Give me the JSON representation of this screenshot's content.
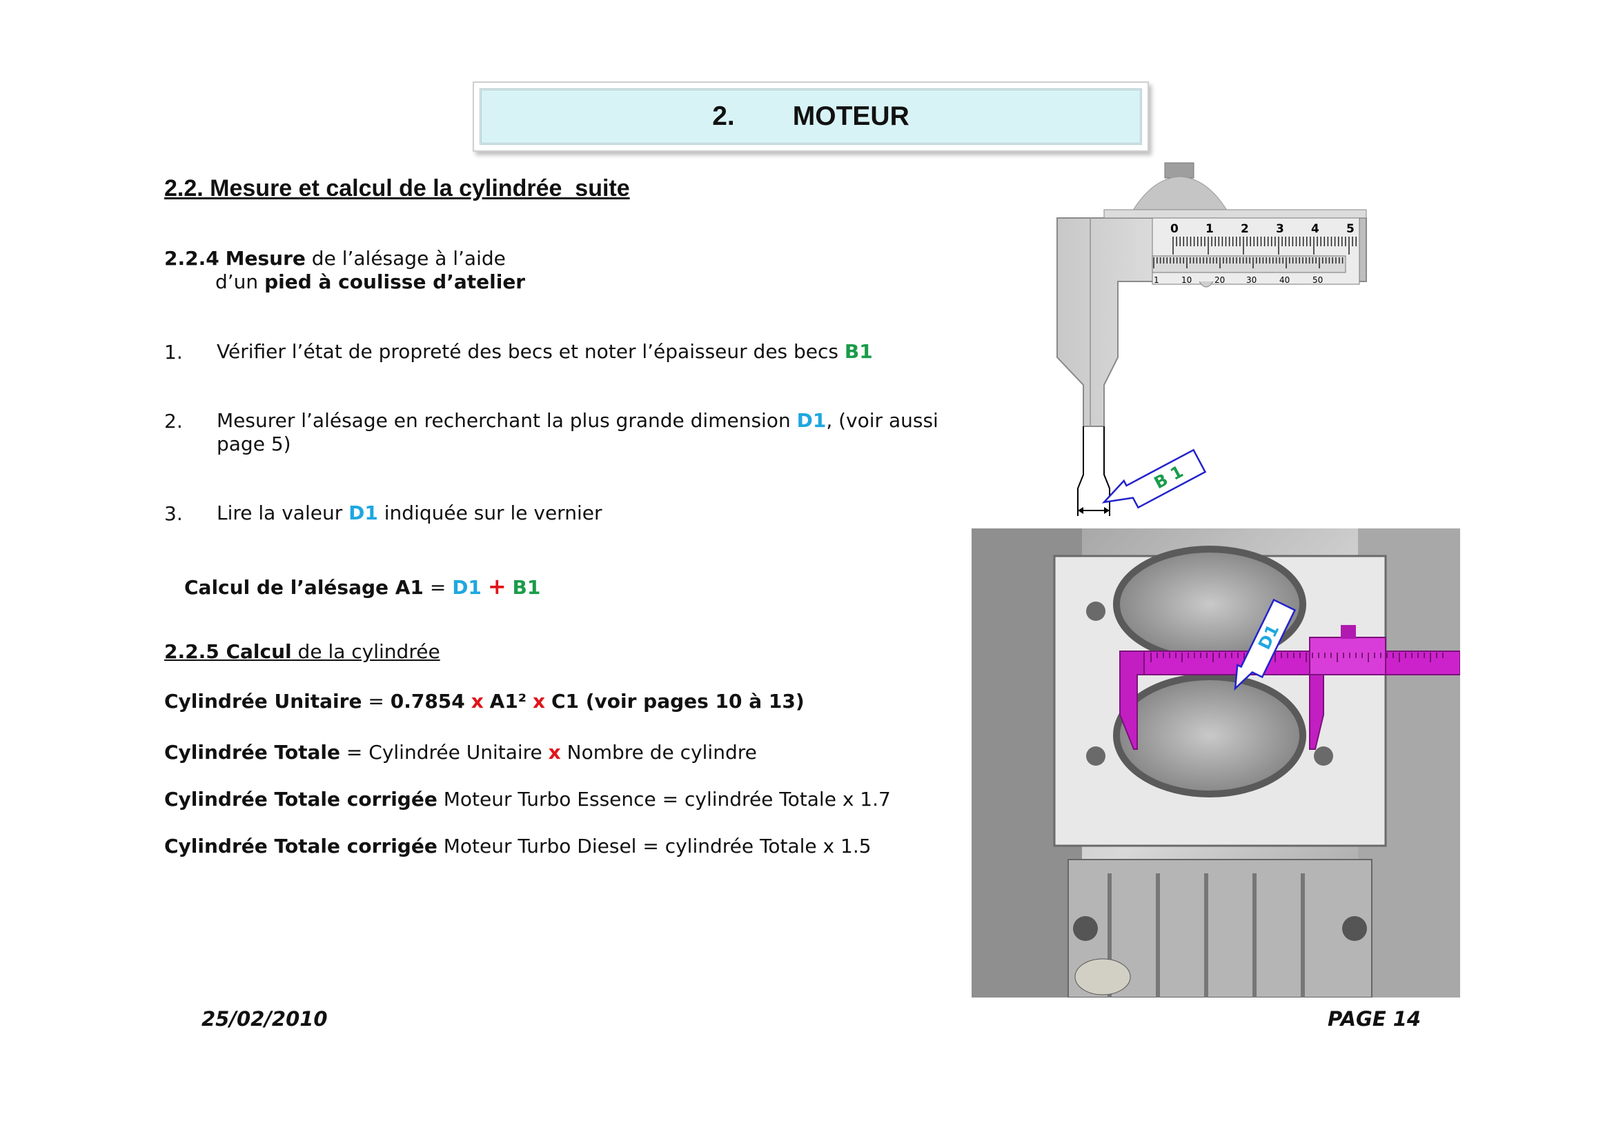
{
  "header": {
    "number": "2.",
    "title": "MOTEUR"
  },
  "section_title": "2.2. Mesure et calcul de la cylindrée  suite",
  "sub_224": {
    "num_bold": "2.2.4",
    "mesure_bold": "Mesure",
    "line1_rest": " de l’alésage à l’aide",
    "line2_prefix": "d’un ",
    "line2_bold": "pied à coulisse d’atelier"
  },
  "steps": [
    {
      "num": "1.",
      "text": "Vérifier l’état de propreté des becs et noter l’épaisseur des becs ",
      "tag": "B1"
    },
    {
      "num": "2.",
      "text": "Mesurer l’alésage en recherchant la plus grande dimension ",
      "tag": "D1",
      "after": ", (voir aussi",
      "line2": "page 5)"
    },
    {
      "num": "3.",
      "text_before": "Lire la valeur ",
      "tag": "D1",
      "text_after": " indiquée sur le vernier"
    }
  ],
  "calc_alesage": {
    "label": "Calcul de l’alésage A1",
    "eq": " = ",
    "d1": "D1",
    "plus": "+",
    "b1": "B1"
  },
  "sub_225": {
    "bold": "2.2.5 Calcul",
    "rest": " de la cylindrée"
  },
  "formulas": {
    "unitaire": {
      "label": "Cylindrée Unitaire",
      "eq": " =  ",
      "coef": "0.7854",
      "x1": "x",
      "a1": "A1²",
      "x2": "x",
      "rest": "C1 (voir pages 10 à 13)"
    },
    "totale": {
      "label": "Cylindrée Totale",
      "rest1": " = Cylindrée Unitaire ",
      "x": "x",
      "rest2": " Nombre de cylindre"
    },
    "essence": {
      "label": "Cylindrée Totale corrigée",
      "rest": " Moteur Turbo Essence = cylindrée Totale x 1.7"
    },
    "diesel": {
      "label": "Cylindrée Totale corrigée",
      "rest": " Moteur Turbo Diesel = cylindrée Totale x 1.5"
    }
  },
  "figure": {
    "caliper_scale_top": [
      "0",
      "1",
      "2",
      "3",
      "4",
      "5"
    ],
    "caliper_scale_bottom": [
      "1",
      "10",
      "20",
      "30",
      "40",
      "50"
    ],
    "tag_b1": "B 1",
    "tag_d1": "D1",
    "colors": {
      "tool_magenta": "#cc22cc",
      "tag_blue": "#2222cc",
      "tag_green": "#1a9c4a"
    }
  },
  "footer": {
    "date": "25/02/2010",
    "page": "PAGE 14"
  }
}
